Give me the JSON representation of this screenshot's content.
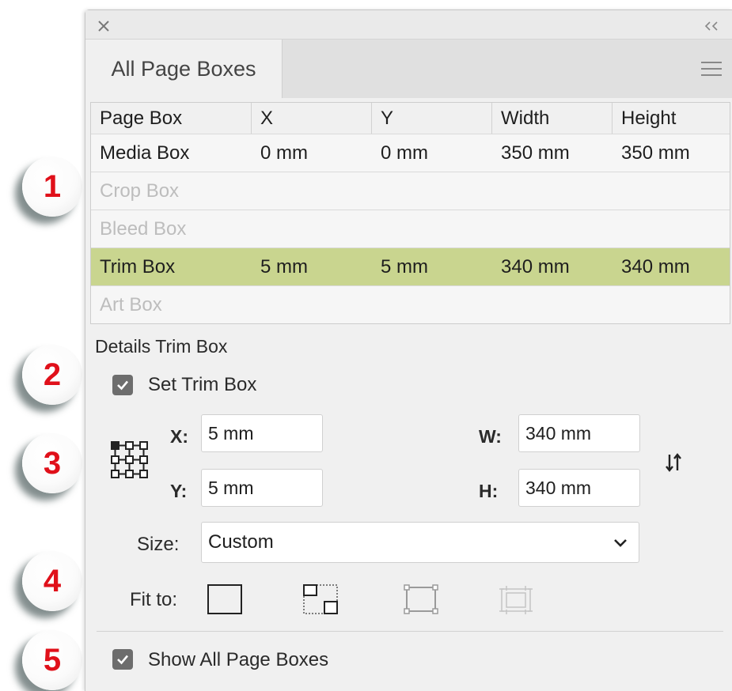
{
  "panel": {
    "tab_label": "All Page Boxes",
    "icons": {
      "close": "close-icon",
      "collapse": "double-chevron-left-icon",
      "menu": "hamburger-menu-icon"
    }
  },
  "table": {
    "headers": [
      "Page Box",
      "X",
      "Y",
      "Width",
      "Height"
    ],
    "rows": [
      {
        "name": "Media Box",
        "x": "0 mm",
        "y": "0 mm",
        "width": "350 mm",
        "height": "350 mm",
        "state": "enabled"
      },
      {
        "name": "Crop Box",
        "x": "",
        "y": "",
        "width": "",
        "height": "",
        "state": "disabled"
      },
      {
        "name": "Bleed Box",
        "x": "",
        "y": "",
        "width": "",
        "height": "",
        "state": "disabled"
      },
      {
        "name": "Trim Box",
        "x": "5 mm",
        "y": "5 mm",
        "width": "340 mm",
        "height": "340 mm",
        "state": "selected"
      },
      {
        "name": "Art Box",
        "x": "",
        "y": "",
        "width": "",
        "height": "",
        "state": "disabled"
      }
    ]
  },
  "details": {
    "title": "Details Trim Box",
    "set_checkbox_label": "Set Trim Box",
    "set_checked": true,
    "x_label": "X:",
    "x_value": "5 mm",
    "y_label": "Y:",
    "y_value": "5 mm",
    "w_label": "W:",
    "w_value": "340 mm",
    "h_label": "H:",
    "h_value": "340 mm",
    "size_label": "Size:",
    "size_value": "Custom",
    "fit_label": "Fit to:",
    "fit_icons": [
      "fit-page-icon",
      "fit-objects-icon",
      "fit-selection-icon",
      "fit-artboard-icon"
    ]
  },
  "footer": {
    "show_all_label": "Show All Page Boxes",
    "show_all_checked": true
  },
  "callouts": [
    "1",
    "2",
    "3",
    "4",
    "5"
  ],
  "colors": {
    "selected_row": "#c9d58f",
    "callout_number": "#e0101a",
    "panel_bg": "#f0f0f0",
    "checkbox": "#6d6d6d"
  }
}
